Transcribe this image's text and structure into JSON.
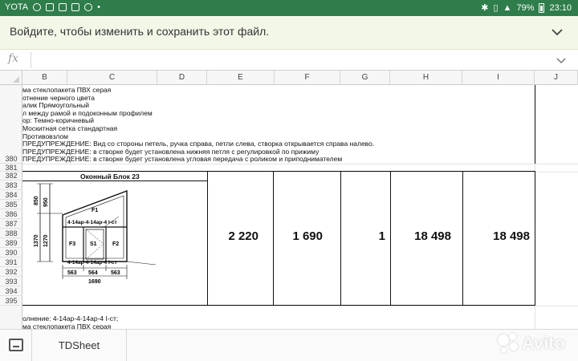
{
  "status_bar": {
    "carrier": "YOTA",
    "battery": "79%",
    "time": "23:10"
  },
  "banner": {
    "message": "Войдите, чтобы изменить и сохранить этот файл."
  },
  "formula_bar": {
    "fx_label": "fx",
    "value": ""
  },
  "columns": [
    "B",
    "C",
    "D",
    "E",
    "F",
    "G",
    "H",
    "I",
    "J"
  ],
  "rows": [
    "380",
    "381",
    "382",
    "383",
    "384",
    "385",
    "386",
    "387",
    "388",
    "389",
    "390",
    "391",
    "392",
    "393",
    "394",
    "395"
  ],
  "notes_top": [
    "ма стеклопакета ПВХ серая",
    "отнение черного цвета",
    "алик Прямоугольный",
    "л между рамой и подоконным профилем",
    "ор: Темно-коричневый",
    " Москитная сетка стандартная",
    " Противовзлом",
    " ПРЕДУПРЕЖДЕНИЕ: Вид со стороны петель, ручка справа, петли слева, створка открывается справа налево.",
    " ПРЕДУПРЕЖДЕНИЕ: в створке будет установлена нижняя петля с регулировкой по прижиму",
    " ПРЕДУПРЕЖДЕНИЕ: в створке будет установлена угловая передача  с роликом и приподнимателем"
  ],
  "block": {
    "title": "Оконный Блок 23",
    "dims_left": [
      "850",
      "950",
      "1370",
      "1270"
    ],
    "labels": [
      "F1",
      "F3",
      "S1",
      "F2"
    ],
    "glass_top": "4-14ар-4-14ар-4 I-ст",
    "glass_bottom": "4-14ар-4-14ар-4 I-ст",
    "dims_bottom": [
      "563",
      "564",
      "563"
    ],
    "total_width": "1690"
  },
  "values": {
    "e": "2 220",
    "f": "1 690",
    "g": "1",
    "h": "18 498",
    "i": "18 498"
  },
  "notes_bottom": [
    "олнение: 4-14ар-4-14ар-4 I-ст;",
    "ма стеклопакета ПВХ серая"
  ],
  "sheet_tab": "TDSheet",
  "watermark": "Avito"
}
